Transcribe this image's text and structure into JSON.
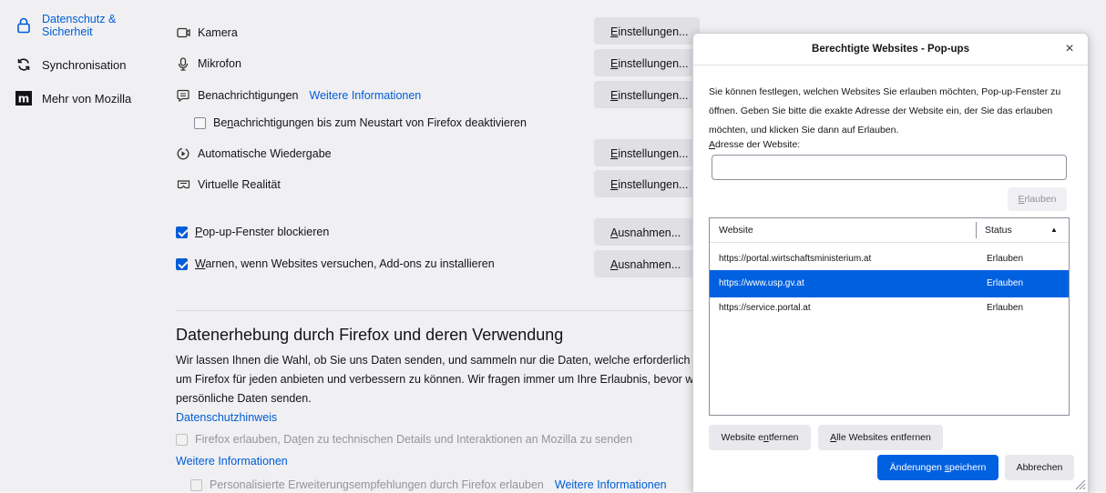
{
  "sidebar": {
    "items": [
      {
        "label": "Datenschutz & Sicherheit",
        "icon": "lock-icon",
        "active": true
      },
      {
        "label": "Synchronisation",
        "icon": "sync-icon"
      },
      {
        "label": "Mehr von Mozilla",
        "icon": "mozilla-icon"
      }
    ]
  },
  "permissions": {
    "camera": "Kamera",
    "microphone": "Mikrofon",
    "notifications": "Benachrichtigungen",
    "notifications_link": "Weitere Informationen",
    "pause_notifications_pre": "Be",
    "pause_notifications_key": "n",
    "pause_notifications_post": "achrichtigungen bis zum Neustart von Firefox deaktivieren",
    "autoplay": "Automatische Wiedergabe",
    "vr": "Virtuelle Realität",
    "settings_key": "E",
    "settings_rest": "instellungen..."
  },
  "blocking": {
    "popups_key": "P",
    "popups_rest": "op-up-Fenster blockieren",
    "addons_key": "W",
    "addons_rest": "arnen, wenn Websites versuchen, Add-ons zu installieren",
    "exceptions_key": "A",
    "exceptions_rest": "usnahmen..."
  },
  "data_collection": {
    "title": "Datenerhebung durch Firefox und deren Verwendung",
    "line1": "Wir lassen Ihnen die Wahl, ob Sie uns Daten senden, und sammeln nur die Daten, welche erforderlich sind",
    "line2": "um Firefox für jeden anbieten und verbessern zu können. Wir fragen immer um Ihre Erlaubnis, bevor wir",
    "line3": "persönliche Daten senden.",
    "privacy_link": "Datenschutzhinweis",
    "telemetry_pre": "Firefox erlauben, Da",
    "telemetry_key": "t",
    "telemetry_post": "en zu technischen Details und Interaktionen an Mozilla zu senden",
    "more_info": "Weitere Informationen",
    "recommendations": "Personalisierte Erweiterungsempfehlungen durch Firefox erlauben",
    "recommendations_link": "Weitere Informationen"
  },
  "dialog": {
    "title": "Berechtigte Websites - Pop-ups",
    "close": "×",
    "desc1": "Sie können festlegen, welchen Websites Sie erlauben möchten, Pop-up-Fenster zu",
    "desc2": "öffnen. Geben Sie bitte die exakte Adresse der Website ein, der Sie das erlauben",
    "desc3": "möchten, und klicken Sie dann auf Erlauben.",
    "address_key": "A",
    "address_rest": "dresse der Website:",
    "address_value": "",
    "allow_key": "E",
    "allow_rest": "rlauben",
    "columns": {
      "website": "Website",
      "status": "Status",
      "sort": "▲"
    },
    "rows": [
      {
        "site": "https://portal.wirtschaftsministerium.at",
        "status": "Erlauben",
        "selected": false
      },
      {
        "site": "https://www.usp.gv.at",
        "status": "Erlauben",
        "selected": true
      },
      {
        "site": "https://service.portal.at",
        "status": "Erlauben",
        "selected": false
      }
    ],
    "remove_pre": "Website e",
    "remove_key": "n",
    "remove_post": "tfernen",
    "remove_all_key": "A",
    "remove_all_rest": "lle Websites entfernen",
    "save_pre": "Änderungen ",
    "save_key": "s",
    "save_post": "peichern",
    "cancel": "Abbrechen",
    "accent": "#0061e0"
  }
}
